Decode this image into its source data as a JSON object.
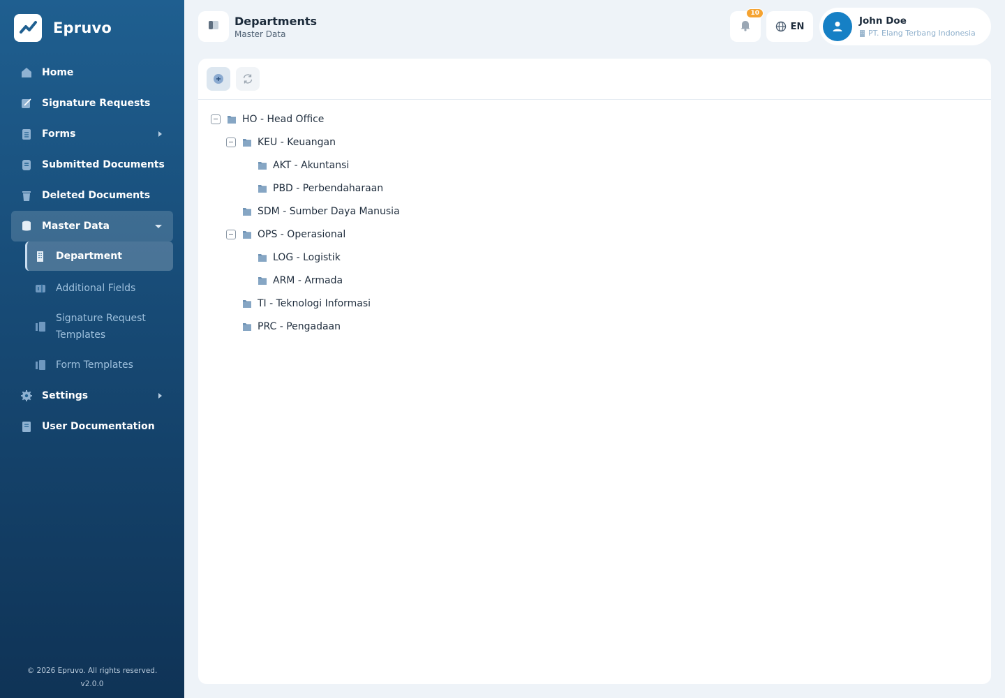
{
  "app": {
    "name": "Epruvo"
  },
  "sidebar": {
    "items": [
      {
        "label": "Home",
        "icon": "home-icon"
      },
      {
        "label": "Signature Requests",
        "icon": "signature-icon"
      },
      {
        "label": "Forms",
        "icon": "forms-icon",
        "has_submenu": true
      },
      {
        "label": "Submitted Documents",
        "icon": "document-icon"
      },
      {
        "label": "Deleted Documents",
        "icon": "trash-icon"
      },
      {
        "label": "Master Data",
        "icon": "database-icon",
        "expanded": true
      },
      {
        "label": "Settings",
        "icon": "gear-icon",
        "has_submenu": true
      },
      {
        "label": "User Documentation",
        "icon": "book-icon"
      }
    ],
    "master_data_sub": [
      {
        "label": "Department",
        "icon": "building-icon",
        "active": true
      },
      {
        "label": "Additional Fields",
        "icon": "fields-icon"
      },
      {
        "label": "Signature Request Templates",
        "icon": "template-icon"
      },
      {
        "label": "Form Templates",
        "icon": "template-icon"
      }
    ],
    "footer_copyright": "© 2026 Epruvo. All rights reserved.",
    "footer_version": "v2.0.0"
  },
  "header": {
    "title": "Departments",
    "subtitle": "Master Data",
    "notification_count": "10",
    "language": "EN",
    "user_name": "John Doe",
    "user_org": "PT. Elang Terbang Indonesia"
  },
  "tree": [
    {
      "label": "HO - Head Office",
      "level": 0,
      "expandable": true
    },
    {
      "label": "KEU - Keuangan",
      "level": 1,
      "expandable": true
    },
    {
      "label": "AKT - Akuntansi",
      "level": 2,
      "expandable": false
    },
    {
      "label": "PBD - Perbendaharaan",
      "level": 2,
      "expandable": false
    },
    {
      "label": "SDM - Sumber Daya Manusia",
      "level": 1,
      "expandable": false
    },
    {
      "label": "OPS - Operasional",
      "level": 1,
      "expandable": true
    },
    {
      "label": "LOG - Logistik",
      "level": 2,
      "expandable": false
    },
    {
      "label": "ARM - Armada",
      "level": 2,
      "expandable": false
    },
    {
      "label": "TI - Teknologi Informasi",
      "level": 1,
      "expandable": false
    },
    {
      "label": "PRC - Pengadaan",
      "level": 1,
      "expandable": false
    }
  ],
  "colors": {
    "sidebar_top": "#1f5f90",
    "sidebar_bottom": "#0f3356",
    "accent": "#1680c5",
    "badge": "#f5a331",
    "folder": "#6f93b5"
  }
}
